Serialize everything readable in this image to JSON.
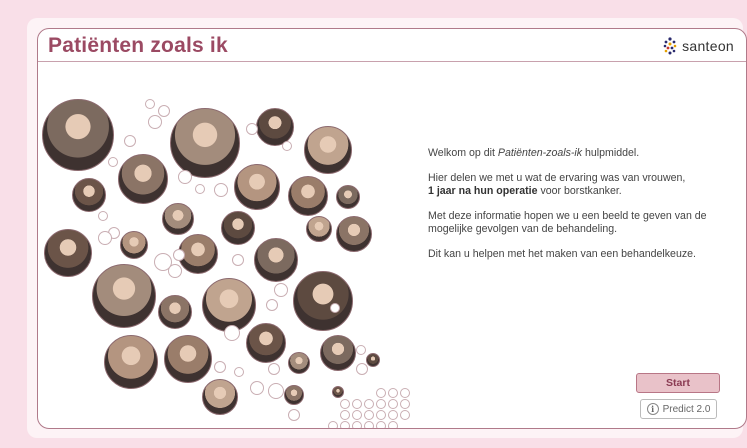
{
  "app": {
    "title": "Patiënten zoals ik",
    "logo_text": "santeon"
  },
  "intro": {
    "p1_prefix": "Welkom op dit ",
    "p1_italic": "Patiënten-zoals-ik",
    "p1_suffix": " hulpmiddel.",
    "p2_prefix": "Hier delen we met u wat de ervaring was van vrouwen,",
    "p2_bold": "1 jaar na hun operatie",
    "p2_suffix": " voor borstkanker.",
    "p3": "Met deze informatie hopen we u een beeld te geven van de mogelijke gevolgen van de behandeling.",
    "p4": "Dit kan u helpen met het maken van een behandelkeuze."
  },
  "buttons": {
    "start_label": "Start",
    "predict_label": "Predict 2.0",
    "info_glyph": "i"
  },
  "colors": {
    "title": "#9b4a63",
    "background": "#f9dfe8",
    "start_bg": "#e9c2c9",
    "photo_border": "#8c6a6f"
  }
}
